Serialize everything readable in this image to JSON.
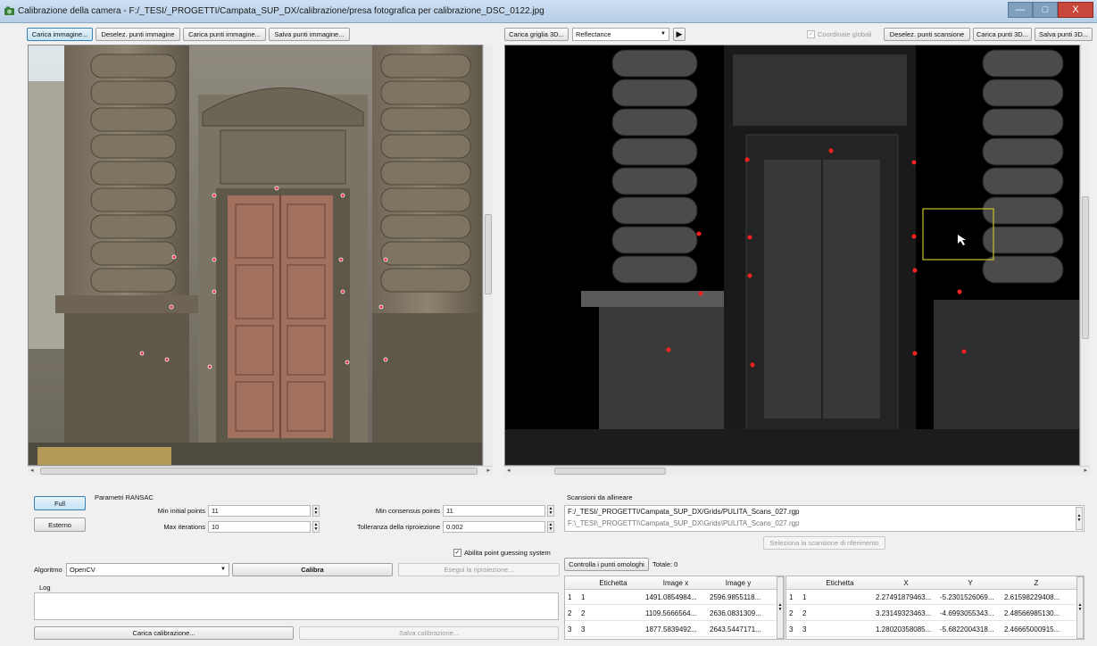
{
  "window": {
    "title": "Calibrazione della camera - F:/_TESI/_PROGETTI/Campata_SUP_DX/calibrazione/presa fotografica per calibrazione_DSC_0122.jpg",
    "controls": {
      "minimize": "—",
      "maximize": "□",
      "close": "X"
    }
  },
  "left_toolbar": {
    "load_image": "Carica immagine...",
    "deselect_points": "Deselez. punti immagine",
    "load_points": "Carica punti immagine...",
    "save_points": "Salva punti immagine..."
  },
  "right_toolbar": {
    "load_grid": "Carica griglia 3D...",
    "mode_select": {
      "selected": "Reflectance"
    },
    "cursor_tool": "▶",
    "global_coords": {
      "label": "Coordinate globali",
      "checked": true,
      "enabled": false
    },
    "deselect_scan_points": "Deselez. punti scansione",
    "load_3d_points": "Carica punti 3D...",
    "save_3d_points": "Salva punti 3D..."
  },
  "mode_buttons": {
    "full": "Full",
    "external": "Esterno"
  },
  "ransac": {
    "title": "Parametri RANSAC",
    "min_initial_points": {
      "label": "Min initial points",
      "value": "11"
    },
    "max_iterations": {
      "label": "Max iterations",
      "value": "10"
    },
    "min_consensus_points": {
      "label": "Min consensus points",
      "value": "11"
    },
    "reprojection_tolerance": {
      "label": "Tolleranza della riproiezione",
      "value": "0.002"
    },
    "guessing_system": {
      "label": "Abilita point guessing system",
      "checked": true
    }
  },
  "algorithm": {
    "label": "Algoritmo",
    "selected": "OpenCV"
  },
  "actions": {
    "calibrate": "Calibra",
    "run_reprojection": "Esegui la riproiezione...",
    "load_calibration": "Carica calibrazione...",
    "save_calibration": "Salva calibrazione..."
  },
  "log": {
    "label": "Log"
  },
  "scans": {
    "title": "Scansioni da allineare",
    "items": [
      "F:/_TESI/_PROGETTI/Campata_SUP_DX/Grids/PULITA_Scans_027.rgp",
      "F:\\_TESI\\_PROGETTI\\Campata_SUP_DX\\Grids\\PULITA_Scans_027.rgp"
    ],
    "select_reference": "Seleziona la scansione di riferimento"
  },
  "homologous": {
    "check_button": "Controlla i punti omologhi",
    "total": "Totale: 0"
  },
  "image_table": {
    "columns": [
      "Etichetta",
      "Image x",
      "Image y"
    ],
    "rows": [
      {
        "n": "1",
        "label": "1",
        "x": "1491.0854984...",
        "y": "2596.9855118..."
      },
      {
        "n": "2",
        "label": "2",
        "x": "1109.5666564...",
        "y": "2636.0831309..."
      },
      {
        "n": "3",
        "label": "3",
        "x": "1877.5839492...",
        "y": "2643.5447171..."
      }
    ]
  },
  "scan_table": {
    "columns": [
      "Etichetta",
      "X",
      "Y",
      "Z"
    ],
    "rows": [
      {
        "n": "1",
        "label": "1",
        "x": "2.27491879463...",
        "y": "-5.2301526069...",
        "z": "2.61598229408..."
      },
      {
        "n": "2",
        "label": "2",
        "x": "3.23149323463...",
        "y": "-4.6993055343...",
        "z": "2.48566985130..."
      },
      {
        "n": "3",
        "label": "3",
        "x": "1.28020358085...",
        "y": "-5.6822004318...",
        "z": "2.46665000915..."
      }
    ]
  },
  "colors": {
    "marker_photo": "#e0304a",
    "marker_scan": "#ff2020",
    "selection_box": "#c7c228",
    "active_button": "#c4e3f6"
  }
}
